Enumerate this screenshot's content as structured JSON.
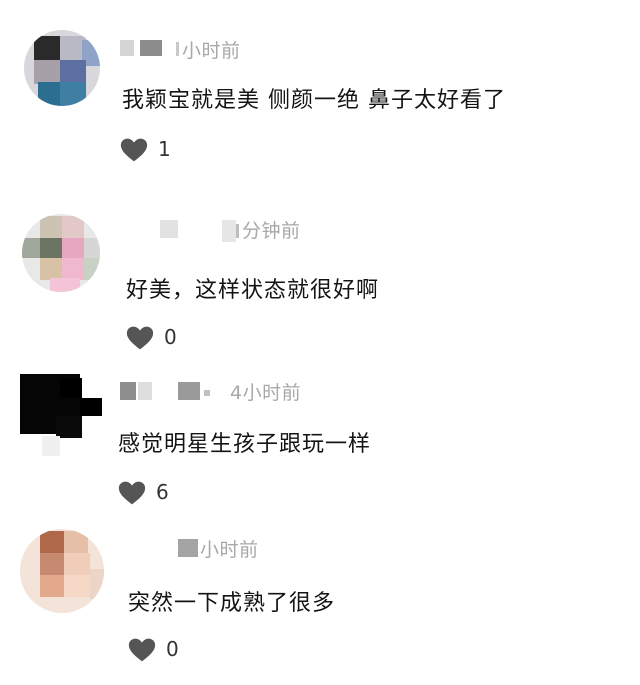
{
  "comments": [
    {
      "time": "小时前",
      "text": "我颖宝就是美 侧颜一绝 鼻子太好看了",
      "likes": "1"
    },
    {
      "time": "分钟前",
      "text": "好美，这样状态就很好啊",
      "likes": "0"
    },
    {
      "time": "4小时前",
      "text": "感觉明星生孩子跟玩一样",
      "likes": "6"
    },
    {
      "time": "小时前",
      "text": "突然一下成熟了很多",
      "likes": "0"
    }
  ],
  "icons": {
    "like": "heart-icon"
  },
  "colors": {
    "text": "#141414",
    "meta": "#a8a8a8",
    "heart": "#555555",
    "background": "#ffffff"
  }
}
